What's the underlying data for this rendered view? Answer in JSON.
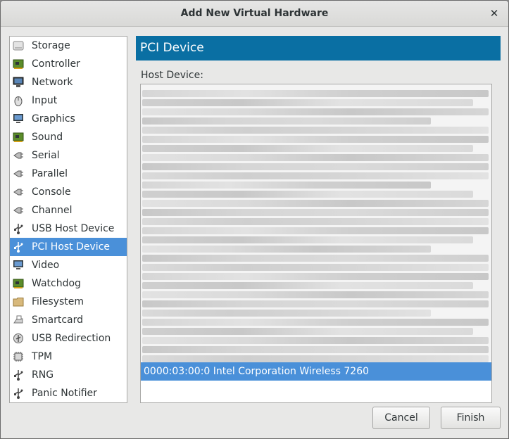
{
  "window": {
    "title": "Add New Virtual Hardware"
  },
  "sidebar": {
    "items": [
      {
        "label": "Storage",
        "icon": "storage-icon"
      },
      {
        "label": "Controller",
        "icon": "controller-icon"
      },
      {
        "label": "Network",
        "icon": "network-icon"
      },
      {
        "label": "Input",
        "icon": "mouse-icon"
      },
      {
        "label": "Graphics",
        "icon": "monitor-icon"
      },
      {
        "label": "Sound",
        "icon": "sound-card-icon"
      },
      {
        "label": "Serial",
        "icon": "serial-plug-icon"
      },
      {
        "label": "Parallel",
        "icon": "parallel-plug-icon"
      },
      {
        "label": "Console",
        "icon": "console-plug-icon"
      },
      {
        "label": "Channel",
        "icon": "channel-plug-icon"
      },
      {
        "label": "USB Host Device",
        "icon": "usb-icon"
      },
      {
        "label": "PCI Host Device",
        "icon": "pci-icon",
        "selected": true
      },
      {
        "label": "Video",
        "icon": "video-monitor-icon"
      },
      {
        "label": "Watchdog",
        "icon": "watchdog-card-icon"
      },
      {
        "label": "Filesystem",
        "icon": "folder-icon"
      },
      {
        "label": "Smartcard",
        "icon": "smartcard-reader-icon"
      },
      {
        "label": "USB Redirection",
        "icon": "usb-redirection-icon"
      },
      {
        "label": "TPM",
        "icon": "chip-icon"
      },
      {
        "label": "RNG",
        "icon": "rng-icon"
      },
      {
        "label": "Panic Notifier",
        "icon": "panic-notifier-icon"
      }
    ]
  },
  "main": {
    "header_title": "PCI Device",
    "host_device_label": "Host Device:",
    "selected_device": "0000:03:00:0 Intel Corporation Wireless 7260"
  },
  "buttons": {
    "cancel": "Cancel",
    "finish": "Finish"
  },
  "colors": {
    "accent_header": "#0a6fa3",
    "selection": "#4a90d9"
  }
}
